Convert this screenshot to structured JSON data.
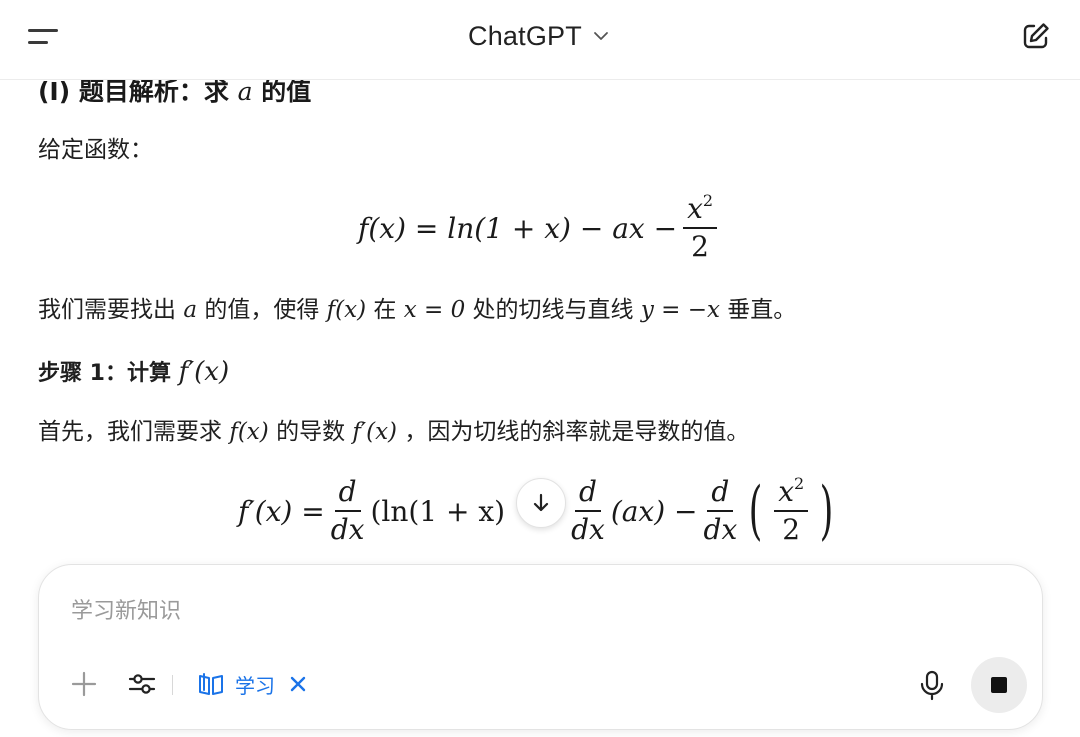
{
  "header": {
    "title": "ChatGPT"
  },
  "content": {
    "heading_prefix": "(I) 题目解析：求",
    "heading_var": "a",
    "heading_suffix": "的值",
    "given_label": "给定函数：",
    "eq1": {
      "lhs": "f(x) = ln(1 + x) − ax −",
      "frac_num": "x",
      "frac_num_exp": "2",
      "frac_den": "2"
    },
    "condition": {
      "p1": "我们需要找出",
      "v1": "a",
      "p2": "的值，使得",
      "v2": "f(x)",
      "p3": "在",
      "v3": "x = 0",
      "p4": "处的切线与直线",
      "v4": "y = −x",
      "p5": "垂直。"
    },
    "step1": {
      "label": "步骤 1：计算",
      "expr": "f′(x)"
    },
    "step1_text": {
      "p1": "首先，我们需要求",
      "v1": "f(x)",
      "p2": "的导数",
      "v2": "f′(x)",
      "p3": "，因为切线的斜率就是导数的值。"
    },
    "eq2": {
      "lhs": "f′(x) =",
      "d": "d",
      "dx": "dx",
      "t1": "(ln(1 + x)",
      "t2": "(ax) −",
      "inner_num": "x",
      "inner_exp": "2",
      "inner_den": "2"
    }
  },
  "composer": {
    "placeholder": "学习新知识",
    "chip_label": "学习"
  },
  "colors": {
    "accent": "#1a73e8",
    "stop_bg": "#ececec"
  },
  "icons": [
    "menu-icon",
    "chevron-down-icon",
    "edit-icon",
    "arrow-down-icon",
    "plus-icon",
    "sliders-icon",
    "book-icon",
    "close-icon",
    "mic-icon",
    "stop-icon"
  ]
}
